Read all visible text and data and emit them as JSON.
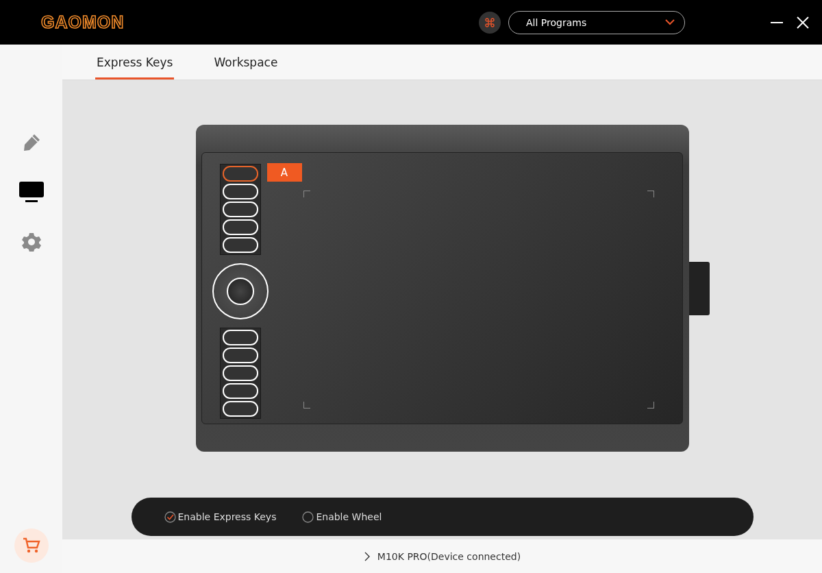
{
  "window": {
    "logo": "GAOMON"
  },
  "program_select": {
    "value": "All Programs"
  },
  "tabs": [
    {
      "label": "Express Keys",
      "selected": true
    },
    {
      "label": "Workspace",
      "selected": false
    }
  ],
  "sidebar": {
    "items": [
      {
        "kind": "pen",
        "selected": false
      },
      {
        "kind": "display",
        "selected": true
      },
      {
        "kind": "settings",
        "selected": false
      }
    ]
  },
  "tablet": {
    "key_label": "A",
    "top_keys": [
      {
        "selected": true
      },
      {
        "selected": false
      },
      {
        "selected": false
      },
      {
        "selected": false
      },
      {
        "selected": false
      }
    ],
    "bottom_keys": [
      {
        "selected": false
      },
      {
        "selected": false
      },
      {
        "selected": false
      },
      {
        "selected": false
      },
      {
        "selected": false
      }
    ]
  },
  "options": [
    {
      "label": "Enable Express Keys",
      "checked": true
    },
    {
      "label": "Enable Wheel",
      "checked": false
    }
  ],
  "status_bar": {
    "device": "M10K PRO(Device connected)"
  }
}
